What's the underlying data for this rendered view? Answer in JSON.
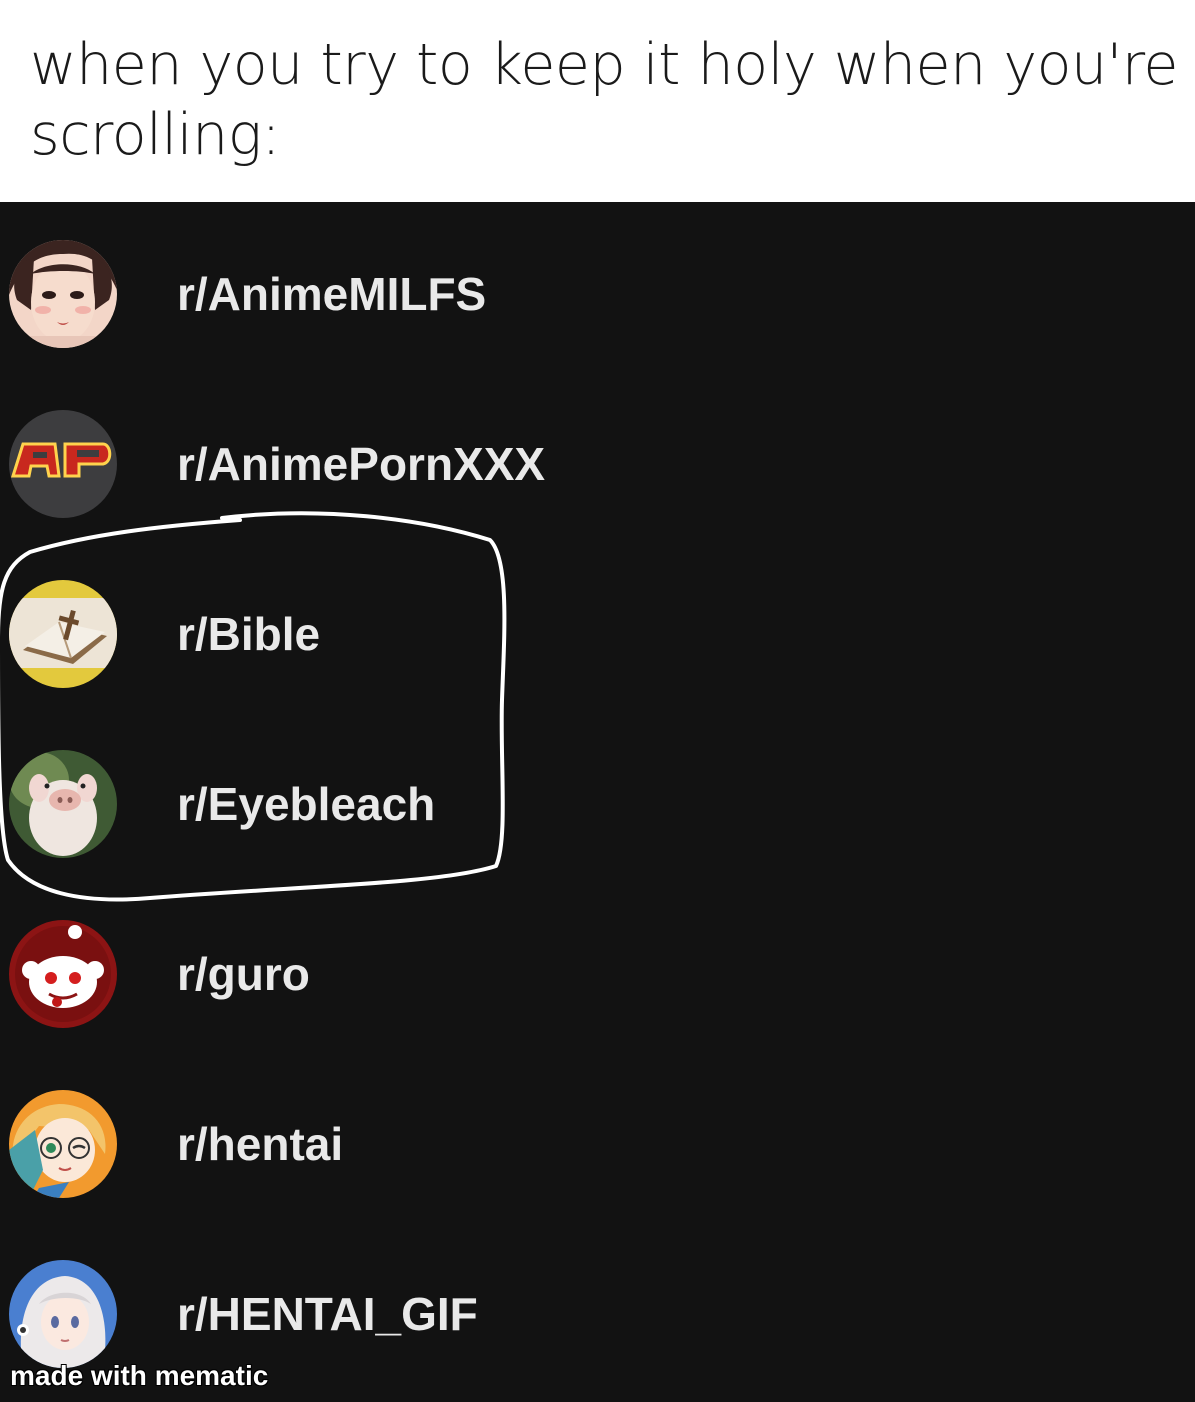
{
  "caption": "when you try to keep it holy when you're scrolling:",
  "communities": [
    {
      "name": "r/AnimeMILFS",
      "icon": "anime-woman-avatar-icon"
    },
    {
      "name": "r/AnimePornXXX",
      "icon": "ap-logo-avatar-icon"
    },
    {
      "name": "r/Bible",
      "icon": "bible-cross-avatar-icon"
    },
    {
      "name": "r/Eyebleach",
      "icon": "piglet-avatar-icon"
    },
    {
      "name": "r/guro",
      "icon": "bloody-snoo-avatar-icon"
    },
    {
      "name": "r/hentai",
      "icon": "winking-anime-girl-avatar-icon"
    },
    {
      "name": "r/HENTAI_GIF",
      "icon": "white-hair-anime-girl-avatar-icon"
    }
  ],
  "watermark": "made with mematic",
  "colors": {
    "background": "#121212",
    "text": "#e9e9e9",
    "caption_bg": "#ffffff",
    "highlight_circle": "#ffffff"
  }
}
